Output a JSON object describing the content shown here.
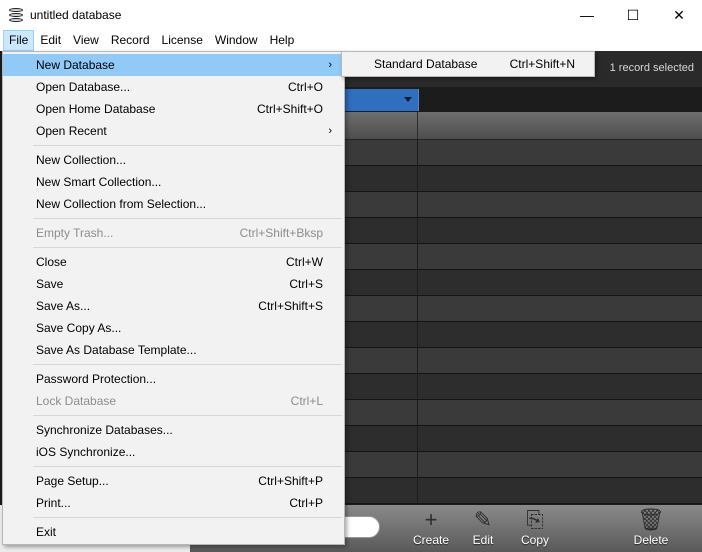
{
  "window": {
    "title": "untitled database",
    "controls": {
      "minimize": "—",
      "maximize": "☐",
      "close": "✕"
    }
  },
  "menubar": [
    "File",
    "Edit",
    "View",
    "Record",
    "License",
    "Window",
    "Help"
  ],
  "status": {
    "record_status": "1 record selected"
  },
  "file_menu": {
    "groups": [
      [
        {
          "label": "New Database",
          "shortcut": "",
          "arrow": "›"
        },
        {
          "label": "Open Database...",
          "shortcut": "Ctrl+O"
        },
        {
          "label": "Open Home Database",
          "shortcut": "Ctrl+Shift+O"
        },
        {
          "label": "Open Recent",
          "shortcut": "",
          "arrow": "›"
        }
      ],
      [
        {
          "label": "New Collection...",
          "shortcut": ""
        },
        {
          "label": "New Smart Collection...",
          "shortcut": ""
        },
        {
          "label": "New Collection from Selection...",
          "shortcut": ""
        }
      ],
      [
        {
          "label": "Empty Trash...",
          "shortcut": "Ctrl+Shift+Bksp"
        }
      ],
      [
        {
          "label": "Close",
          "shortcut": "Ctrl+W"
        },
        {
          "label": "Save",
          "shortcut": "Ctrl+S"
        },
        {
          "label": "Save As...",
          "shortcut": "Ctrl+Shift+S"
        },
        {
          "label": "Save Copy As...",
          "shortcut": ""
        },
        {
          "label": "Save As Database Template...",
          "shortcut": ""
        }
      ],
      [
        {
          "label": "Password Protection...",
          "shortcut": ""
        },
        {
          "label": "Lock Database",
          "shortcut": "Ctrl+L"
        }
      ],
      [
        {
          "label": "Synchronize Databases...",
          "shortcut": ""
        },
        {
          "label": "iOS Synchronize...",
          "shortcut": ""
        }
      ],
      [
        {
          "label": "Page Setup...",
          "shortcut": "Ctrl+Shift+P"
        },
        {
          "label": "Print...",
          "shortcut": "Ctrl+P"
        }
      ],
      [
        {
          "label": "Exit",
          "shortcut": ""
        }
      ]
    ]
  },
  "submenu": {
    "label": "Standard Database",
    "shortcut": "Ctrl+Shift+N"
  },
  "toolbar": {
    "create": {
      "label": "Create",
      "icon": "+"
    },
    "edit": {
      "label": "Edit",
      "icon": "✎"
    },
    "copy": {
      "label": "Copy",
      "icon": "⎘"
    },
    "delete": {
      "label": "Delete",
      "icon": "🗑"
    }
  }
}
